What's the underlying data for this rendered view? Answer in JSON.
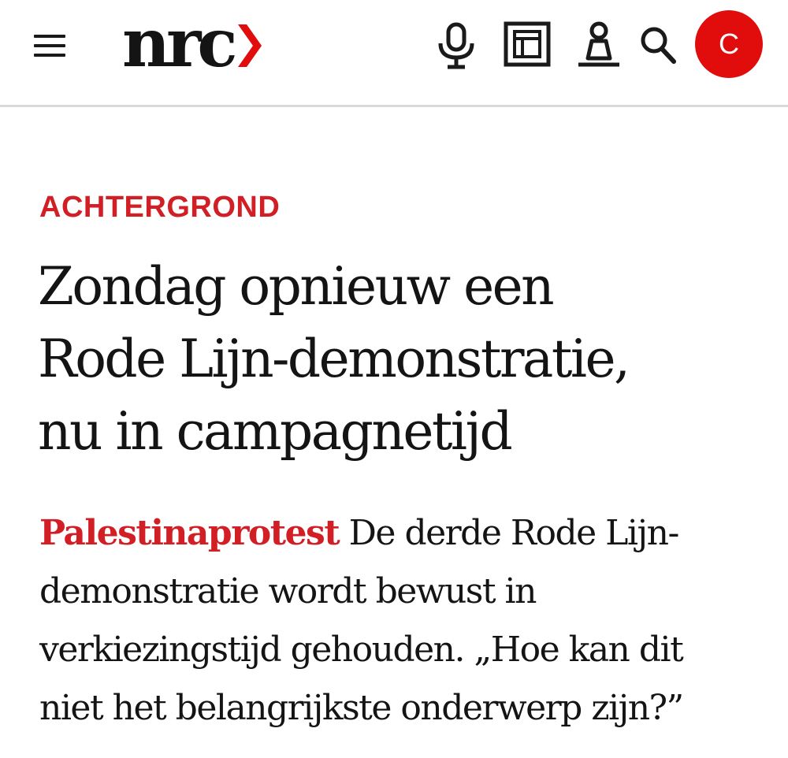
{
  "header": {
    "logo_text": "nrc",
    "avatar_initial": "C",
    "icons": [
      "menu-icon",
      "microphone-icon",
      "newspaper-icon",
      "chess-pawn-icon",
      "search-icon"
    ],
    "brand_color": "#e10d0d"
  },
  "article": {
    "kicker": "ACHTERGROND",
    "headline_lines": [
      "Zondag opnieuw een",
      "Rode Lijn-demonstratie,",
      "nu in campagnetijd"
    ],
    "intro_kicker": "Palestinaprotest",
    "intro_lines": [
      " De derde Rode Lijn-",
      "demonstratie wordt bewust in",
      "verkiezingstijd gehouden. „Hoe kan dit",
      "niet het belangrijkste onderwerp zijn?”"
    ],
    "accent_color": "#d11f25"
  }
}
